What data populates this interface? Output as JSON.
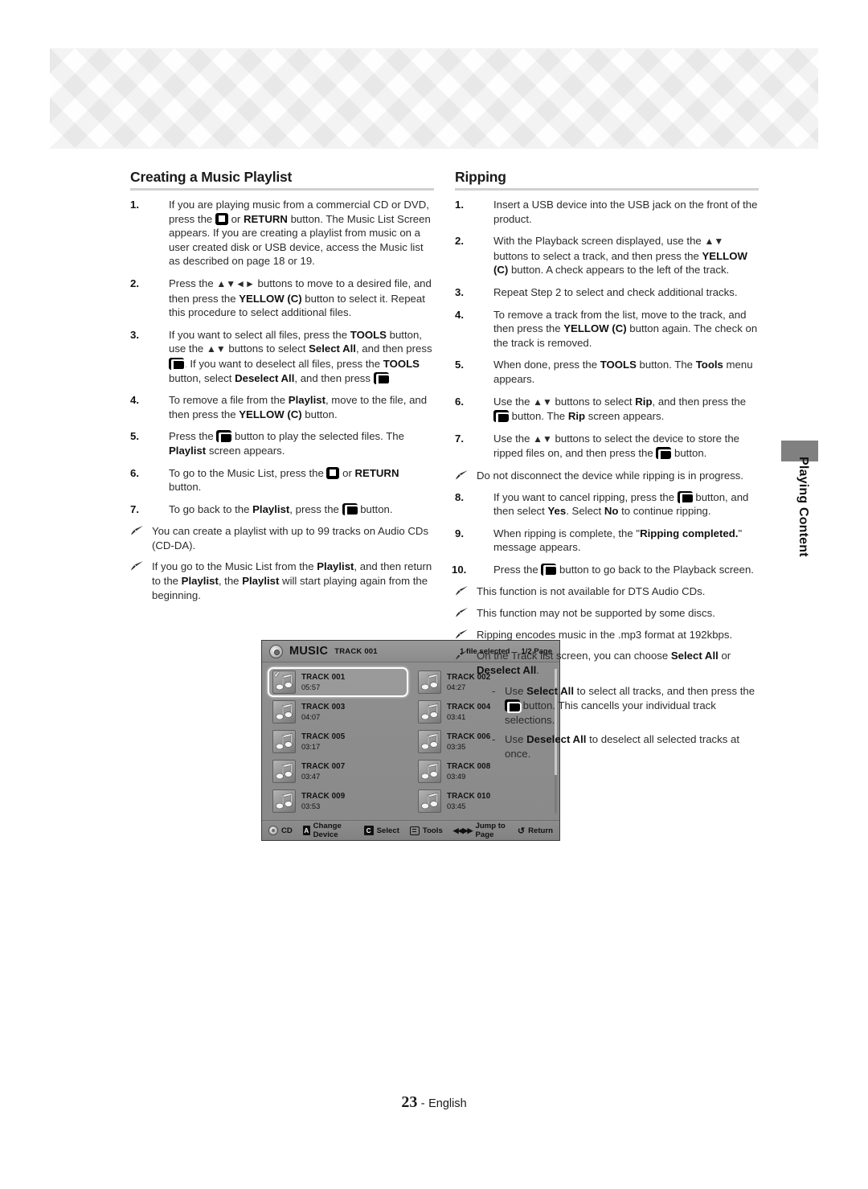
{
  "page": {
    "number": "23",
    "separator": "-",
    "language": "English"
  },
  "side_tab": {
    "label": "Playing Content"
  },
  "left_column": {
    "title": "Creating a Music Playlist",
    "steps": [
      {
        "num": "1.",
        "html": "If you are playing music from a commercial CD or DVD, press the <span class=\"key-stop\" data-name=\"stop-key-icon\"></span> or <b>RETURN</b> button. The Music List Screen appears. If you are creating a playlist from music on a user created disk or USB device, access the Music list as described on page 18 or 19."
      },
      {
        "num": "2.",
        "html": "Press the <span class=\"arrows\">▲▼◄►</span> buttons to move to a desired file, and then press the <b>YELLOW (C)</b> button to select it. Repeat this procedure to select additional files."
      },
      {
        "num": "3.",
        "html": "If you want to select all files, press the <b>TOOLS</b> button, use the <span class=\"arrows\">▲▼</span> buttons to select <b>Select All</b>, and then press <span class=\"key-enter\" data-name=\"enter-key-icon\"></span>. If you want to deselect all files, press the <b>TOOLS</b> button, select <b>Deselect All</b>, and then press <span class=\"key-enter\" data-name=\"enter-key-icon\"></span>."
      }
    ],
    "steps_after": [
      {
        "num": "4.",
        "html": "To remove a file from the <b>Playlist</b>, move to the file, and then press the <b>YELLOW (C)</b> button."
      },
      {
        "num": "5.",
        "html": "Press the <span class=\"key-enter\" data-name=\"enter-key-icon\"></span> button to play the selected files. The <b>Playlist</b> screen appears."
      },
      {
        "num": "6.",
        "html": "To go to the Music List, press the <span class=\"key-stop\" data-name=\"stop-key-icon\"></span> or <b>RETURN</b> button."
      },
      {
        "num": "7.",
        "html": "To go back to the <b>Playlist</b>, press the <span class=\"key-enter\" data-name=\"enter-key-icon\"></span> button."
      }
    ],
    "notes": [
      {
        "html": "You can create a playlist with up to 99 tracks on Audio CDs (CD-DA)."
      },
      {
        "html": "If you go to the Music List from the <b>Playlist</b>, and then return to the <b>Playlist</b>, the <b>Playlist</b> will start playing again from the beginning."
      }
    ]
  },
  "right_column": {
    "title": "Ripping",
    "steps": [
      {
        "num": "1.",
        "html": "Insert a USB device into the USB jack on the front of the product."
      },
      {
        "num": "2.",
        "html": "With the Playback screen displayed, use the <span class=\"arrows\">▲▼</span> buttons to select a track, and then press the <b>YELLOW (C)</b> button. A check appears to the left of the track."
      },
      {
        "num": "3.",
        "html": "Repeat Step 2 to select and check additional tracks."
      },
      {
        "num": "4.",
        "html": "To remove a track from the list, move to the track, and then press the <b>YELLOW (C)</b> button again. The check on the track is removed."
      },
      {
        "num": "5.",
        "html": "When done, press the <b>TOOLS</b> button. The <b>Tools</b> menu appears."
      },
      {
        "num": "6.",
        "html": "Use the <span class=\"arrows\">▲▼</span> buttons to select <b>Rip</b>, and then press the <span class=\"key-enter\" data-name=\"enter-key-icon\"></span> button. The <b>Rip</b> screen appears."
      },
      {
        "num": "7.",
        "html": "Use the <span class=\"arrows\">▲▼</span> buttons to select the device to store the ripped files on, and then press the <span class=\"key-enter\" data-name=\"enter-key-icon\"></span> button."
      }
    ],
    "note_mid": {
      "html": "Do not disconnect the device while ripping is in progress."
    },
    "steps_after": [
      {
        "num": "8.",
        "html": "If you want to cancel ripping, press the <span class=\"key-enter\" data-name=\"enter-key-icon\"></span> button, and then select <b>Yes</b>. Select <b>No</b> to continue ripping."
      },
      {
        "num": "9.",
        "html": "When ripping is complete, the \"<b>Ripping completed.</b>\" message appears."
      },
      {
        "num": "10.",
        "html": "Press the <span class=\"key-enter\" data-name=\"enter-key-icon\"></span> button to go back to the Playback screen."
      }
    ],
    "notes": [
      {
        "html": "This function is not available for DTS Audio CDs."
      },
      {
        "html": "This function may not be supported by some discs."
      },
      {
        "html": "Ripping encodes music in the .mp3 format at 192kbps."
      },
      {
        "html": "On the Track list screen, you can choose <b>Select All</b> or <b>Deselect All</b>."
      }
    ],
    "sub_notes": [
      {
        "dash": "-",
        "html": "Use <b>Select All</b> to select all tracks, and then press the <span class=\"key-enter\" data-name=\"enter-key-icon\"></span> button. This cancells your individual track selections."
      },
      {
        "dash": "-",
        "html": "Use <b>Deselect All</b> to deselect all selected tracks at once."
      }
    ]
  },
  "music_screen": {
    "header": {
      "title": "MUSIC",
      "subtitle": "TRACK 001",
      "selected_count": "1 file selected",
      "page": "1/2 Page"
    },
    "tracks": [
      {
        "name": "TRACK 001",
        "time": "05:57",
        "selected": true,
        "checked": true
      },
      {
        "name": "TRACK 002",
        "time": "04:27",
        "selected": false,
        "checked": false
      },
      {
        "name": "TRACK 003",
        "time": "04:07",
        "selected": false,
        "checked": false
      },
      {
        "name": "TRACK 004",
        "time": "03:41",
        "selected": false,
        "checked": false
      },
      {
        "name": "TRACK 005",
        "time": "03:17",
        "selected": false,
        "checked": false
      },
      {
        "name": "TRACK 006",
        "time": "03:35",
        "selected": false,
        "checked": false
      },
      {
        "name": "TRACK 007",
        "time": "03:47",
        "selected": false,
        "checked": false
      },
      {
        "name": "TRACK 008",
        "time": "03:49",
        "selected": false,
        "checked": false
      },
      {
        "name": "TRACK 009",
        "time": "03:53",
        "selected": false,
        "checked": false
      },
      {
        "name": "TRACK 010",
        "time": "03:45",
        "selected": false,
        "checked": false
      }
    ],
    "footer": [
      {
        "icon": "disc-icon",
        "label": "CD"
      },
      {
        "icon": "badge-a",
        "label": "Change Device"
      },
      {
        "icon": "badge-c",
        "label": "Select"
      },
      {
        "icon": "tools-icon",
        "label": "Tools"
      },
      {
        "icon": "jump-arrows-icon",
        "label": "Jump to Page"
      },
      {
        "icon": "return-icon",
        "label": "Return"
      }
    ]
  },
  "colors": {
    "screen_bg": "#8e8e8e",
    "rule": "#d0d0d0",
    "side_tab": "#808080",
    "text": "#2b2b2b"
  }
}
